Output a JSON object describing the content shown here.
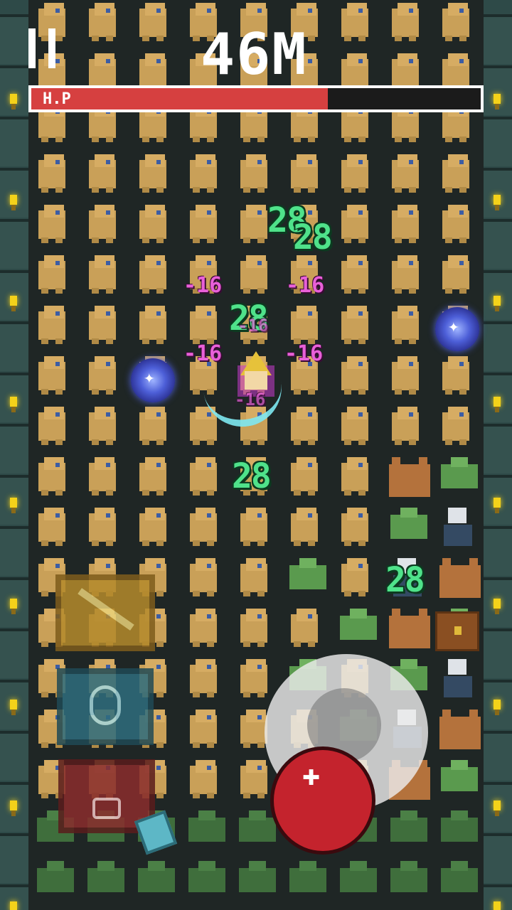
{
  "hud": {
    "distance": "46M",
    "hp_label": "H.P",
    "hp_fraction": 0.66,
    "pause_icon": "pause-icon"
  },
  "damage_numbers": {
    "green": [
      "28",
      "28",
      "28",
      "28",
      "28"
    ],
    "pink": [
      "-16",
      "-16",
      "-16",
      "-16",
      "-16",
      "-16"
    ]
  },
  "controls": {
    "skills": [
      {
        "name": "sword-skill",
        "icon": "sword-icon"
      },
      {
        "name": "shield-skill",
        "icon": "shield-icon"
      },
      {
        "name": "fist-skill",
        "icon": "fist-icon"
      }
    ],
    "joystick_icon": "joystick",
    "attack_icon": "plus-icon"
  },
  "colors": {
    "hp": "#d64040",
    "damage_green": "#4fe28a",
    "damage_pink": "#e860d8",
    "mob": "#c9a058",
    "wall": "#2e4a48"
  }
}
